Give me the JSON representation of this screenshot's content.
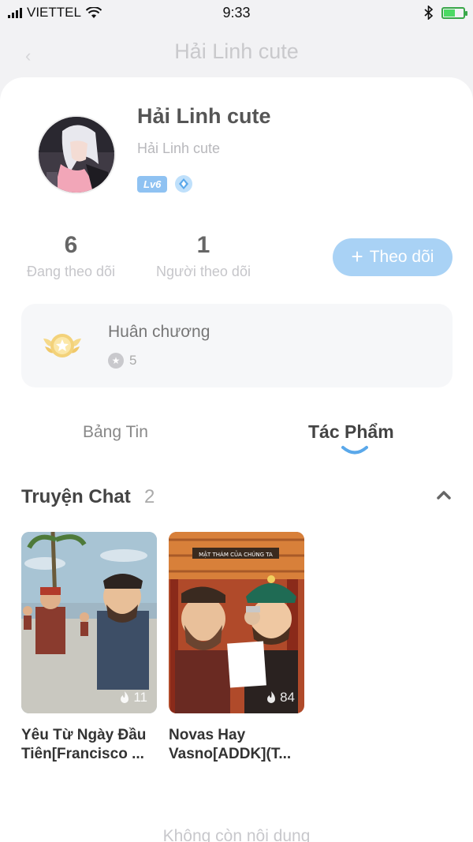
{
  "status_bar": {
    "carrier": "VIETTEL",
    "time": "9:33",
    "battery_level": 0.6
  },
  "header": {
    "title": "Hải Linh cute"
  },
  "profile": {
    "name": "Hải Linh cute",
    "handle": "Hải Linh cute",
    "level": "Lv6"
  },
  "stats": [
    {
      "value": "6",
      "label": "Đang theo dõi"
    },
    {
      "value": "1",
      "label": "Người theo dõi"
    }
  ],
  "follow_button": {
    "label": "Theo dõi",
    "color": "#a9d2f5"
  },
  "medals": {
    "title": "Huân chương",
    "count": "5"
  },
  "tabs": [
    {
      "label": "Bảng Tin",
      "active": false
    },
    {
      "label": "Tác Phẩm",
      "active": true
    }
  ],
  "section": {
    "title": "Truyện Chat",
    "count": "2"
  },
  "stories": [
    {
      "title_line1": "Yêu Từ Ngày Đầu",
      "title_line2": "Tiên[Francisco ...",
      "likes": "11"
    },
    {
      "title_line1": "Novas Hay",
      "title_line2": "Vasno[ADDK](T...",
      "likes": "84"
    }
  ],
  "footer": {
    "end_text": "Không còn nội dung"
  },
  "colors": {
    "accent": "#8fc2f2",
    "tab_indicator": "#5aa8ea"
  }
}
